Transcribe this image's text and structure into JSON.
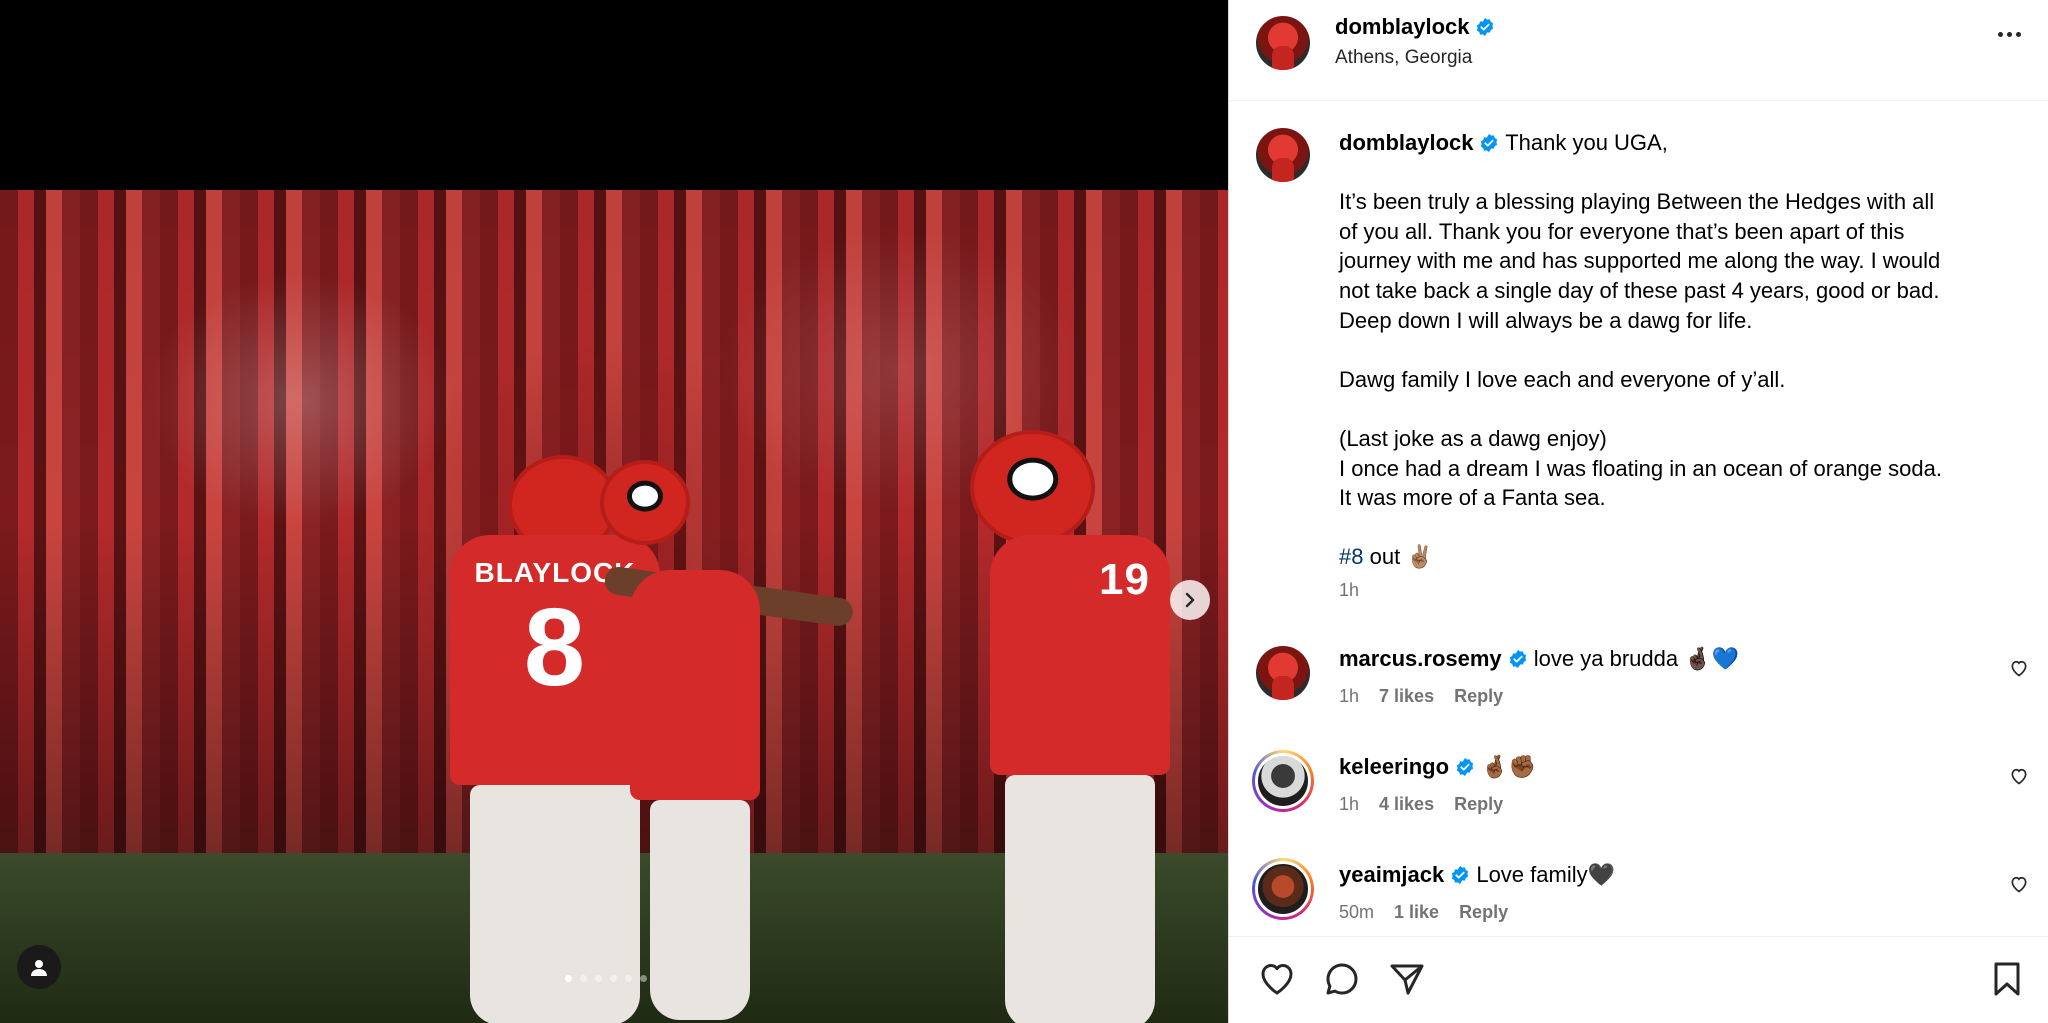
{
  "post": {
    "username": "domblaylock",
    "location": "Athens, Georgia",
    "caption": {
      "lines": [
        "Thank you UGA,",
        "",
        "It’s been truly a blessing playing Between the Hedges with all",
        "of you all. Thank you for everyone that’s been apart of this",
        "journey with me and has supported me along the way. I would",
        "not take back a single day of these past 4 years, good or bad.",
        "Deep down I will always be a dawg for life.",
        "",
        "Dawg family I love each and everyone of y’all.",
        "",
        "(Last joke as a dawg enjoy)",
        "I once had a dream I was floating in an ocean of orange soda.",
        "It was more of a Fanta sea.",
        ""
      ],
      "hashtag": "#8",
      "final_text": " out ✌🏽"
    },
    "time": "1h",
    "carousel": {
      "count": 6,
      "active_index": 0
    },
    "jersey": {
      "name": "BLAYLOCK",
      "number_left": "8",
      "number_right": "19"
    }
  },
  "comments": [
    {
      "username": "marcus.rosemy",
      "text": "love ya brudda 🤞🏿💙",
      "time": "1h",
      "likes": "7 likes",
      "reply": "Reply"
    },
    {
      "username": "keleeringo",
      "text": "🤞🏾✊🏾",
      "time": "1h",
      "likes": "4 likes",
      "reply": "Reply"
    },
    {
      "username": "yeaimjack",
      "text": "Love family🖤",
      "time": "50m",
      "likes": "1 like",
      "reply": "Reply"
    }
  ],
  "colors": {
    "verified": "#0095f6",
    "hashtag": "#00376b",
    "muted": "#737373"
  },
  "icons": [
    "more-options-icon",
    "verified-badge-icon",
    "heart-icon",
    "comment-icon",
    "share-icon",
    "bookmark-icon",
    "next-arrow-icon",
    "tag-user-icon"
  ]
}
